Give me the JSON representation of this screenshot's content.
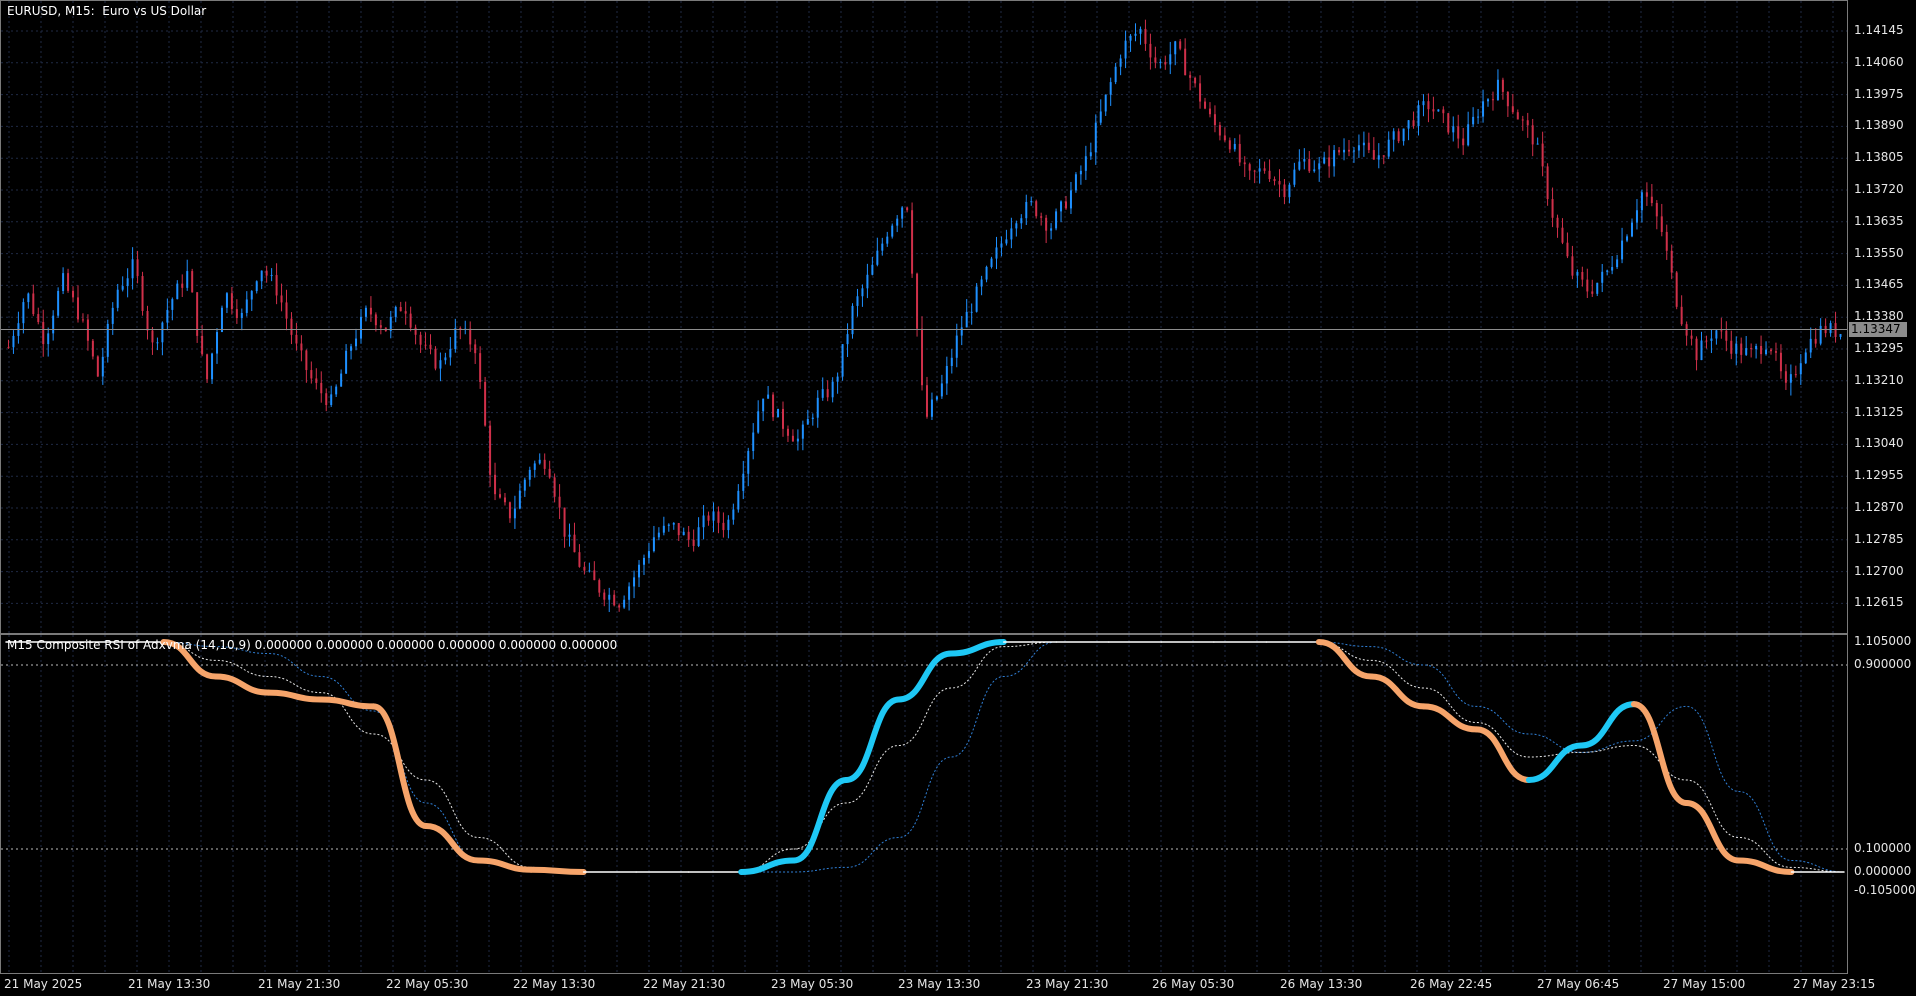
{
  "symbol_title": "EURUSD, M15:  Euro vs US Dollar",
  "indicator_title": "M15 Composite RSI of Adxvma (14,10,9) 0.000000 0.000000 0.000000 0.000000 0.000000 0.000000",
  "colors": {
    "background": "#000000",
    "grid": "#1f2a44",
    "bull_candle": "#1e90ff",
    "bear_candle": "#d0304a",
    "indicator_up": "#1ec8f5",
    "indicator_down": "#f6a46a",
    "price_line": "#8c8c8c"
  },
  "price_axis": [
    "1.14145",
    "1.14060",
    "1.13975",
    "1.13890",
    "1.13805",
    "1.13720",
    "1.13635",
    "1.13550",
    "1.13465",
    "1.13380",
    "1.13295",
    "1.13210",
    "1.13125",
    "1.13040",
    "1.12955",
    "1.12870",
    "1.12785",
    "1.12700",
    "1.12615"
  ],
  "current_price": "1.13347",
  "indicator_axis": [
    "1.105000",
    "0.900000",
    "0.100000",
    "0.000000",
    "-0.105000"
  ],
  "time_axis": [
    "21 May 2025",
    "21 May 13:30",
    "21 May 21:30",
    "22 May 05:30",
    "22 May 13:30",
    "22 May 21:30",
    "23 May 05:30",
    "23 May 13:30",
    "23 May 21:30",
    "26 May 05:30",
    "26 May 13:30",
    "26 May 22:45",
    "27 May 06:45",
    "27 May 15:00",
    "27 May 23:15"
  ],
  "chart_data": {
    "type": "line",
    "price_path": [
      1.133,
      1.1345,
      1.1332,
      1.1348,
      1.1338,
      1.1322,
      1.1345,
      1.1352,
      1.133,
      1.1342,
      1.135,
      1.132,
      1.1345,
      1.1338,
      1.1352,
      1.1345,
      1.133,
      1.132,
      1.1315,
      1.133,
      1.134,
      1.1335,
      1.1342,
      1.133,
      1.1325,
      1.1335,
      1.133,
      1.129,
      1.1285,
      1.1298,
      1.13,
      1.128,
      1.127,
      1.1265,
      1.1262,
      1.127,
      1.128,
      1.1282,
      1.1278,
      1.1285,
      1.1282,
      1.13,
      1.1318,
      1.131,
      1.1305,
      1.1315,
      1.132,
      1.134,
      1.135,
      1.1362,
      1.137,
      1.131,
      1.132,
      1.1335,
      1.1345,
      1.1355,
      1.1365,
      1.1368,
      1.1362,
      1.137,
      1.138,
      1.1395,
      1.141,
      1.1415,
      1.1405,
      1.141,
      1.14,
      1.139,
      1.1385,
      1.1375,
      1.1378,
      1.1372,
      1.138,
      1.1378,
      1.1382,
      1.1385,
      1.138,
      1.1385,
      1.139,
      1.1395,
      1.139,
      1.1385,
      1.1395,
      1.14,
      1.1392,
      1.1385,
      1.1365,
      1.135,
      1.1345,
      1.135,
      1.136,
      1.1372,
      1.1362,
      1.134,
      1.1328,
      1.1335,
      1.133,
      1.1328,
      1.1332,
      1.1318,
      1.133,
      1.1335,
      1.1334
    ],
    "indicator_series": [
      {
        "name": "",
        "values": [
          1.0,
          1.0,
          1.0,
          1.0,
          0.85,
          0.78,
          0.75,
          0.72,
          0.2,
          0.05,
          0.01,
          0.0,
          0.0,
          0.0,
          0.0,
          0.05,
          0.4,
          0.75,
          0.95,
          1.0,
          1.0,
          1.0,
          1.0,
          1.0,
          1.0,
          1.0,
          0.85,
          0.72,
          0.62,
          0.4,
          0.55,
          0.73,
          0.3,
          0.05,
          0.0,
          0.0
        ]
      },
      {
        "name": "",
        "values": [
          1.0,
          1.0,
          1.0,
          1.0,
          0.92,
          0.85,
          0.78,
          0.6,
          0.4,
          0.15,
          0.02,
          0.0,
          0.0,
          0.0,
          0.0,
          0.1,
          0.3,
          0.55,
          0.8,
          0.98,
          1.0,
          1.0,
          1.0,
          1.0,
          1.0,
          1.0,
          0.92,
          0.8,
          0.65,
          0.5,
          0.52,
          0.55,
          0.4,
          0.15,
          0.02,
          0.0
        ]
      },
      {
        "name": "",
        "values": [
          1.0,
          1.0,
          1.0,
          1.0,
          0.98,
          0.95,
          0.85,
          0.7,
          0.3,
          0.05,
          0.0,
          0.0,
          0.0,
          0.0,
          0.0,
          0.0,
          0.02,
          0.15,
          0.5,
          0.85,
          1.0,
          1.0,
          1.0,
          1.0,
          1.0,
          1.0,
          0.98,
          0.9,
          0.72,
          0.6,
          0.52,
          0.57,
          0.72,
          0.35,
          0.05,
          0.0
        ]
      }
    ],
    "levels": [
      0.9,
      0.1
    ],
    "ylim": [
      -0.105,
      1.105
    ],
    "grid": true
  }
}
